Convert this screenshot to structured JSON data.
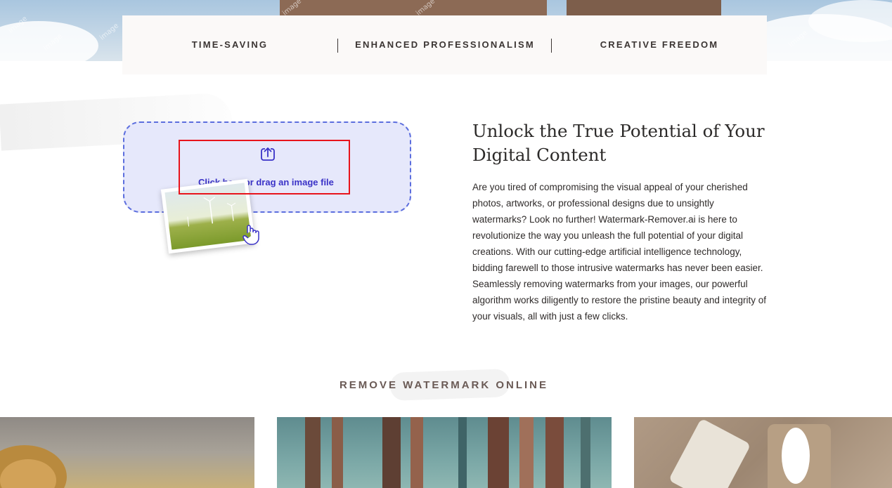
{
  "features": {
    "items": [
      "TIME-SAVING",
      "ENHANCED PROFESSIONALISM",
      "CREATIVE FREEDOM"
    ]
  },
  "upload": {
    "label": "Click here or drag an image file",
    "icon": "upload-icon",
    "accent_color": "#3a32c7",
    "border_color": "#5c6ede",
    "background_color": "#e6e8fb"
  },
  "intro": {
    "headline": "Unlock the True Potential of Your Digital Content",
    "body": "Are you tired of compromising the visual appeal of your cherished photos, artworks, or professional designs due to unsightly watermarks? Look no further! Watermark-Remover.ai is here to revolutionize the way you unleash the full potential of your digital creations. With our cutting-edge artificial intelligence technology, bidding farewell to those intrusive watermarks has never been easier. Seamlessly removing watermarks from your images, our powerful algorithm works diligently to restore the pristine beauty and integrity of your visuals, all with just a few clicks."
  },
  "section": {
    "title": "REMOVE WATERMARK ONLINE"
  },
  "colors": {
    "highlight": "#e8141c",
    "text_dark": "#2c2a29",
    "section_title": "#6a5a55"
  }
}
